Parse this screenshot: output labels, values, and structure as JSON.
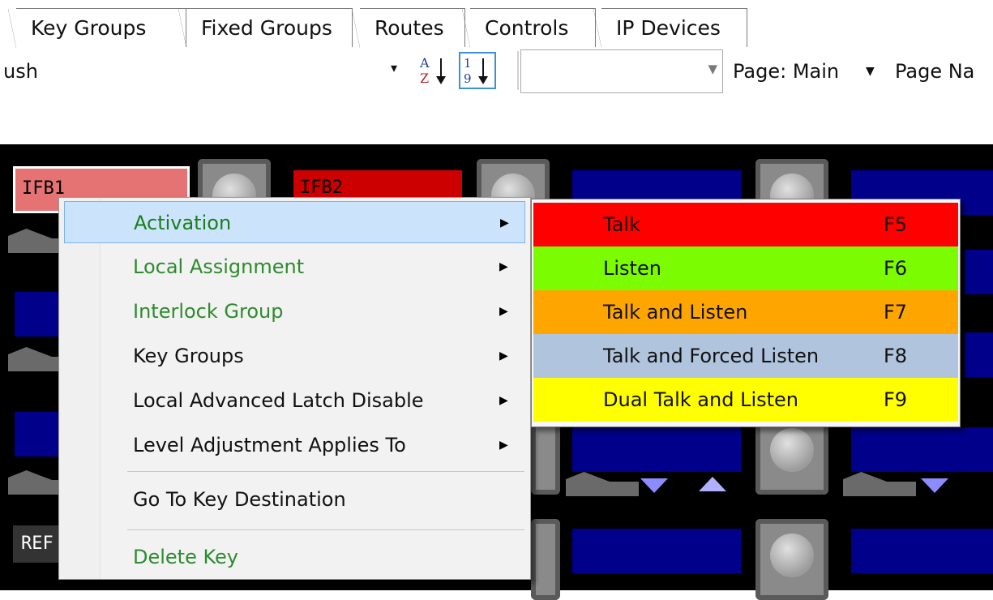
{
  "tabs": [
    {
      "label": "Key Groups"
    },
    {
      "label": "Fixed Groups"
    },
    {
      "label": "Routes"
    },
    {
      "label": "Controls"
    },
    {
      "label": "IP Devices"
    }
  ],
  "toolbar": {
    "left_text": "ush",
    "dropdown_arrow": "▾",
    "sort_az_label": "A Z",
    "sort_19_label": "1 9",
    "combo_value": "",
    "page_label": "Page: Main",
    "page_name_label": "Page Na"
  },
  "keys": {
    "ifb1": "IFB1",
    "ifb2": "IFB2",
    "ref": "REF"
  },
  "context_menu": {
    "items": [
      {
        "label": "Activation",
        "color": "#1a7f1a",
        "has_submenu": true,
        "highlighted": true
      },
      {
        "label": "Local Assignment",
        "color": "#2e8b2e",
        "has_submenu": true
      },
      {
        "label": "Interlock Group",
        "color": "#2e8b2e",
        "has_submenu": true
      },
      {
        "label": "Key Groups",
        "color": "#111111",
        "has_submenu": true
      },
      {
        "label": "Local Advanced Latch Disable",
        "color": "#111111",
        "has_submenu": true
      },
      {
        "label": "Level Adjustment Applies To",
        "color": "#111111",
        "has_submenu": true
      },
      {
        "label": "Go To Key Destination",
        "color": "#111111",
        "has_submenu": false
      },
      {
        "label": "Delete Key",
        "color": "#2e8b2e",
        "has_submenu": false
      }
    ]
  },
  "activation_submenu": {
    "items": [
      {
        "label": "Talk",
        "shortcut": "F5",
        "bg": "#ff0000"
      },
      {
        "label": "Listen",
        "shortcut": "F6",
        "bg": "#7cfc00"
      },
      {
        "label": "Talk and Listen",
        "shortcut": "F7",
        "bg": "#ffa500"
      },
      {
        "label": "Talk and Forced Listen",
        "shortcut": "F8",
        "bg": "#b0c4de"
      },
      {
        "label": "Dual Talk and Listen",
        "shortcut": "F9",
        "bg": "#ffff00"
      }
    ]
  },
  "colors": {
    "panel_bg": "#000000",
    "key_blue": "#00008b",
    "ifb1_bg": "#e57373",
    "ifb2_bg": "#cc0000"
  }
}
